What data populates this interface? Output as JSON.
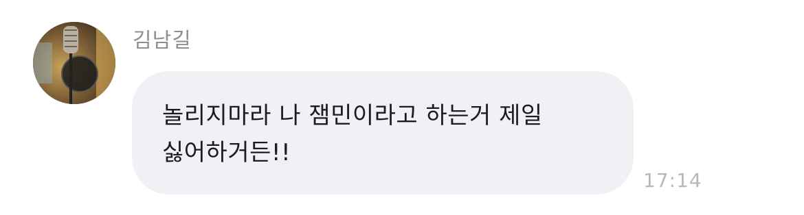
{
  "message": {
    "sender_name": "김남길",
    "avatar": "profile-photo-studio-microphone",
    "text": "놀리지마라 나 잼민이라고 하는거 제일 싫어하거든!!",
    "time": "17:14",
    "bubble_color": "#f1f1f5",
    "text_color": "#1c1c1e",
    "meta_color": "#8e8e93"
  }
}
